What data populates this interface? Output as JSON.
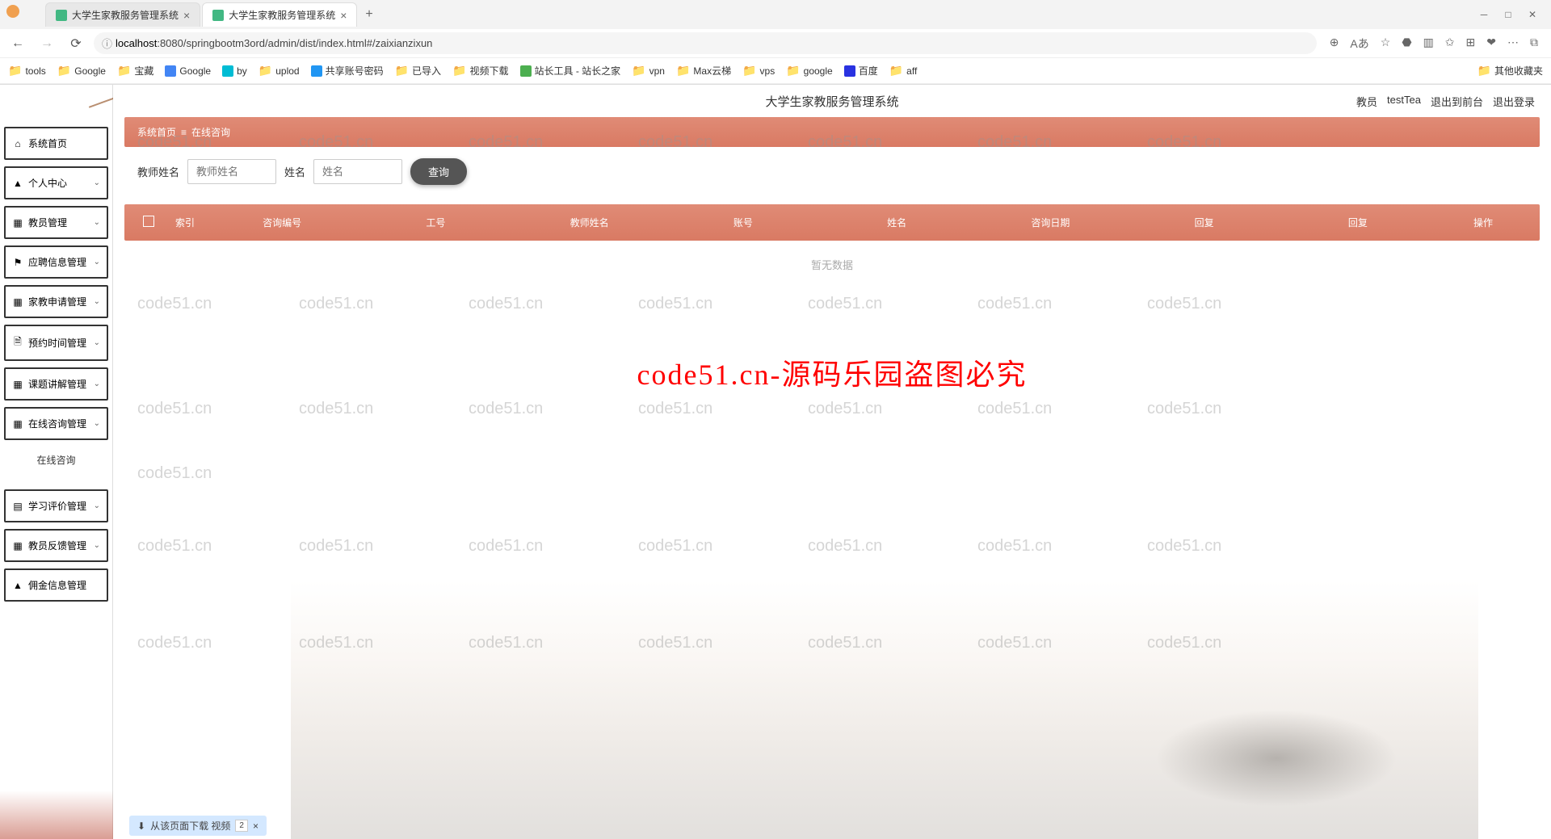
{
  "browser": {
    "tabs": [
      {
        "title": "大学生家教服务管理系统"
      },
      {
        "title": "大学生家教服务管理系统"
      }
    ],
    "url_host": "localhost",
    "url_path": ":8080/springbootm3ord/admin/dist/index.html#/zaixianzixun",
    "bookmarks": [
      {
        "label": "tools",
        "type": "folder"
      },
      {
        "label": "Google",
        "type": "folder"
      },
      {
        "label": "宝藏",
        "type": "folder"
      },
      {
        "label": "Google",
        "type": "icon",
        "color": "#4285f4"
      },
      {
        "label": "by",
        "type": "icon",
        "color": "#00bcd4"
      },
      {
        "label": "uplod",
        "type": "folder"
      },
      {
        "label": "共享账号密码",
        "type": "icon",
        "color": "#2196f3"
      },
      {
        "label": "已导入",
        "type": "folder"
      },
      {
        "label": "视频下载",
        "type": "folder"
      },
      {
        "label": "站长工具 - 站长之家",
        "type": "icon",
        "color": "#4caf50"
      },
      {
        "label": "vpn",
        "type": "folder"
      },
      {
        "label": "Max云梯",
        "type": "folder"
      },
      {
        "label": "vps",
        "type": "folder"
      },
      {
        "label": "google",
        "type": "folder"
      },
      {
        "label": "百度",
        "type": "icon",
        "color": "#2932e1"
      },
      {
        "label": "aff",
        "type": "folder"
      }
    ],
    "bookmark_overflow": "其他收藏夹"
  },
  "header": {
    "title": "大学生家教服务管理系统",
    "user_role": "教员",
    "user_name": "testTea",
    "logout_front": "退出到前台",
    "logout": "退出登录"
  },
  "sidebar": {
    "items": [
      {
        "icon": "home",
        "label": "系统首页",
        "has_children": false
      },
      {
        "icon": "person",
        "label": "个人中心",
        "has_children": true
      },
      {
        "icon": "grid",
        "label": "教员管理",
        "has_children": true
      },
      {
        "icon": "flag",
        "label": "应聘信息管理",
        "has_children": true
      },
      {
        "icon": "grid",
        "label": "家教申请管理",
        "has_children": true
      },
      {
        "icon": "calendar",
        "label": "预约时间管理",
        "has_children": true
      },
      {
        "icon": "grid",
        "label": "课题讲解管理",
        "has_children": true
      },
      {
        "icon": "grid",
        "label": "在线咨询管理",
        "has_children": true
      }
    ],
    "submenu_active": "在线咨询",
    "items_after": [
      {
        "icon": "book",
        "label": "学习评价管理",
        "has_children": true
      },
      {
        "icon": "grid",
        "label": "教员反馈管理",
        "has_children": true
      },
      {
        "icon": "person",
        "label": "佣金信息管理",
        "has_children": false
      }
    ]
  },
  "breadcrumb": {
    "home": "系统首页",
    "sep": "≡",
    "current": "在线咨询"
  },
  "search": {
    "label1": "教师姓名",
    "placeholder1": "教师姓名",
    "label2": "姓名",
    "placeholder2": "姓名",
    "button": "查询"
  },
  "table": {
    "headers": [
      "索引",
      "咨询编号",
      "工号",
      "教师姓名",
      "账号",
      "姓名",
      "咨询日期",
      "回复",
      "回复",
      "操作"
    ],
    "empty_text": "暂无数据"
  },
  "watermark": {
    "repeat_text": "code51.cn",
    "main_text": "code51.cn-源码乐园盗图必究"
  },
  "notification": {
    "text": "从该页面下载 视频",
    "count": "2",
    "close": "×"
  }
}
